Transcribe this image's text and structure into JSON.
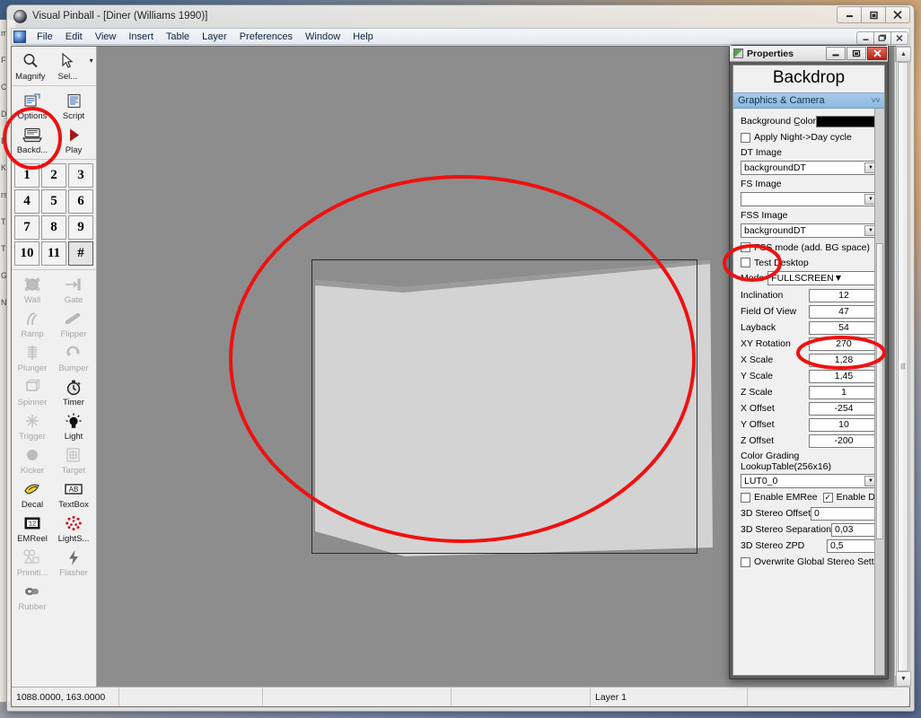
{
  "window": {
    "title": "Visual Pinball - [Diner (Williams 1990)]",
    "minimize": "–",
    "maximize": "□",
    "close": "✕",
    "inner_minimize": "–",
    "inner_restore": "❐",
    "inner_close": "✕"
  },
  "menubar": {
    "items": [
      {
        "label": "File"
      },
      {
        "label": "Edit"
      },
      {
        "label": "View"
      },
      {
        "label": "Insert"
      },
      {
        "label": "Table"
      },
      {
        "label": "Layer"
      },
      {
        "label": "Preferences"
      },
      {
        "label": "Window"
      },
      {
        "label": "Help"
      }
    ]
  },
  "toolbox": {
    "top_tools": [
      {
        "label": "Magnify",
        "icon": "magnify-icon",
        "enabled": true
      },
      {
        "label": "Sel...",
        "icon": "cursor-select-icon",
        "enabled": true
      }
    ],
    "dropdown_caret": "▾",
    "second_tools": [
      {
        "label": "Options",
        "icon": "options-icon",
        "enabled": true
      },
      {
        "label": "Script",
        "icon": "script-icon",
        "enabled": true
      },
      {
        "label": "Backd...",
        "icon": "backdrop-icon",
        "enabled": true
      },
      {
        "label": "Play",
        "icon": "play-icon",
        "enabled": true
      }
    ],
    "layers": [
      "1",
      "2",
      "3",
      "4",
      "5",
      "6",
      "7",
      "8",
      "9",
      "10",
      "11",
      "#"
    ],
    "elements": [
      {
        "label": "Wall",
        "icon": "wall-icon",
        "enabled": false
      },
      {
        "label": "Gate",
        "icon": "gate-icon",
        "enabled": false
      },
      {
        "label": "Ramp",
        "icon": "ramp-icon",
        "enabled": false
      },
      {
        "label": "Flipper",
        "icon": "flipper-icon",
        "enabled": false
      },
      {
        "label": "Plunger",
        "icon": "plunger-icon",
        "enabled": false
      },
      {
        "label": "Bumper",
        "icon": "bumper-icon",
        "enabled": false
      },
      {
        "label": "Spinner",
        "icon": "spinner-icon",
        "enabled": false
      },
      {
        "label": "Timer",
        "icon": "timer-icon",
        "enabled": true
      },
      {
        "label": "Trigger",
        "icon": "trigger-icon",
        "enabled": false
      },
      {
        "label": "Light",
        "icon": "light-icon",
        "enabled": true
      },
      {
        "label": "Kicker",
        "icon": "kicker-icon",
        "enabled": false
      },
      {
        "label": "Target",
        "icon": "target-icon",
        "enabled": false
      },
      {
        "label": "Decal",
        "icon": "decal-icon",
        "enabled": true
      },
      {
        "label": "TextBox",
        "icon": "textbox-icon",
        "enabled": true
      },
      {
        "label": "EMReel",
        "icon": "emreel-icon",
        "enabled": true
      },
      {
        "label": "LightS...",
        "icon": "light-sequencer-icon",
        "enabled": true
      },
      {
        "label": "Primiti...",
        "icon": "primitive-icon",
        "enabled": false
      },
      {
        "label": "Flasher",
        "icon": "flasher-icon",
        "enabled": false
      },
      {
        "label": "Rubber",
        "icon": "rubber-icon",
        "enabled": false
      }
    ]
  },
  "statusbar": {
    "coordinates": "1088.0000, 163.0000",
    "pane2": "",
    "pane3": "",
    "pane4": "",
    "layer": "Layer 1",
    "pane6": ""
  },
  "properties": {
    "window_title": "Properties",
    "heading": "Backdrop",
    "section": {
      "label": "Graphics & Camera",
      "chevron": "˅˅"
    },
    "fields": {
      "background_color_label": "Background C̲olor",
      "background_color_value": "#000000",
      "apply_night_day_label": "Apply Night->Day cycle",
      "apply_night_day_checked": false,
      "dt_image_label": "DT Image",
      "dt_image_value": "backgroundDT",
      "fs_image_label": "FS Image",
      "fs_image_value": "",
      "fss_image_label": "FSS Image",
      "fss_image_value": "backgroundDT",
      "fss_mode_label": "FSS mode (add. BG space)",
      "fss_mode_checked": false,
      "test_desktop_label": "Test Desktop",
      "test_desktop_checked": false,
      "mode_label": "Mode",
      "mode_value": "FULLSCREEN",
      "inclination_label": "Inclination",
      "inclination_value": "12",
      "fov_label": "Field Of View",
      "fov_value": "47",
      "layback_label": "Layback",
      "layback_value": "54",
      "xy_rotation_label": "XY Rotation",
      "xy_rotation_value": "270",
      "x_scale_label": "X Scale",
      "x_scale_value": "1,28",
      "y_scale_label": "Y Scale",
      "y_scale_value": "1,45",
      "z_scale_label": "Z Scale",
      "z_scale_value": "1",
      "x_offset_label": "X Offset",
      "x_offset_value": "-254",
      "y_offset_label": "Y Offset",
      "y_offset_value": "10",
      "z_offset_label": "Z Offset",
      "z_offset_value": "-200",
      "lut_label": "Color Grading LookupTable(256x16)",
      "lut_value": "LUT0_0",
      "enable_emree_label": "Enable EMRee",
      "enable_emree_checked": false,
      "enable_decal_label": "Enable Deca",
      "enable_decal_checked": true,
      "stereo_offset_label": "3D Stereo Offset",
      "stereo_offset_value": "0",
      "stereo_separation_label": "3D Stereo Separation",
      "stereo_separation_value": "0,03",
      "stereo_zpd_label": "3D Stereo ZPD",
      "stereo_zpd_value": "0,5",
      "overwrite_global_label": "Overwrite Global Stereo Settings",
      "overwrite_global_checked": false
    }
  },
  "annotations": {
    "accent_color": "#ee1111",
    "marks": [
      {
        "name": "backdrop-button-highlight"
      },
      {
        "name": "fss-mode-checkbox-highlight"
      },
      {
        "name": "xy-rotation-highlight"
      },
      {
        "name": "playfield-highlight"
      }
    ]
  },
  "background_window": {
    "lines": [
      "m",
      "F",
      "C",
      "D",
      "E",
      "K",
      "rs",
      "T",
      "T",
      "G",
      "N"
    ]
  }
}
